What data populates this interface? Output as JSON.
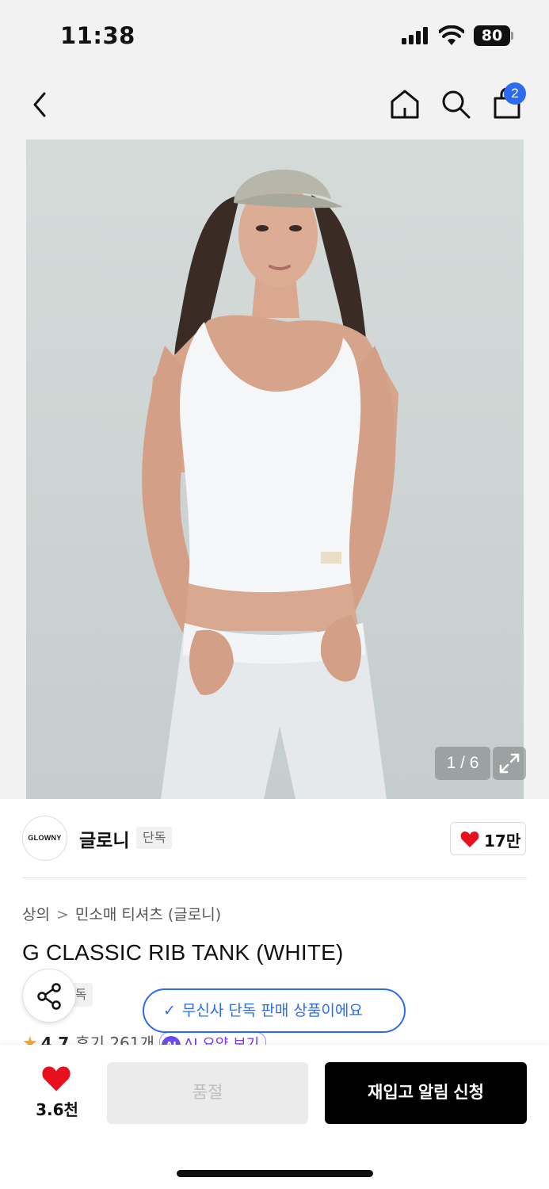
{
  "status_bar": {
    "time": "11:38",
    "battery": "80"
  },
  "nav": {
    "cart_count": "2",
    "icons": [
      "back-icon",
      "home-icon",
      "search-icon",
      "shopping-bag-icon"
    ]
  },
  "gallery": {
    "counter": "1 / 6",
    "current_index": 1,
    "total": 6
  },
  "brand": {
    "logo_text": "GLOWNY",
    "name": "글로니",
    "badge": "단독",
    "like_count": "17만"
  },
  "product": {
    "breadcrumb": [
      "상의",
      "민소매 티셔츠 (글로니)"
    ],
    "title": "G CLASSIC RIB TANK (WHITE)",
    "tag": "단독",
    "rating": "4.7",
    "reviews": "후기 261개",
    "ai_badge": "AI",
    "ai_summary": "AI 요약 보기"
  },
  "toast": {
    "message": "무신사 단독 판매 상품이에요"
  },
  "bottom_bar": {
    "wish_count": "3.6천",
    "soldout_label": "품절",
    "restock_label": "재입고 알림 신청"
  },
  "colors": {
    "accent_blue": "#2a6bf2",
    "heart_red": "#e8101f",
    "primary_button": "#000000",
    "disabled_button": "#ebebeb"
  }
}
